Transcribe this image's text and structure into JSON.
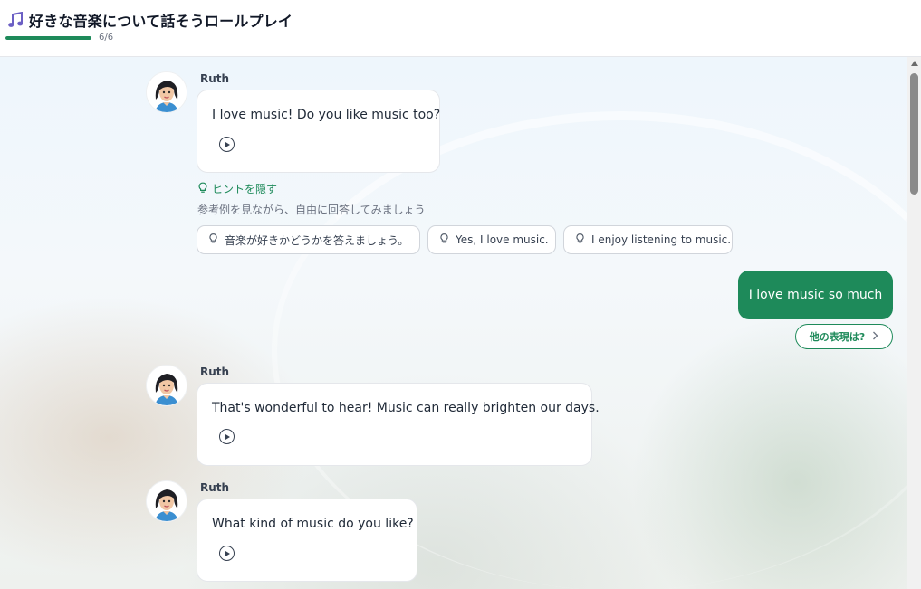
{
  "header": {
    "title": "好きな音楽について話そうロールプレイ",
    "icon": "music-note-icon",
    "progress_text": "6/6",
    "progress_fraction": 1.0,
    "accent_color": "#1e8a5a"
  },
  "messages": [
    {
      "sender": "Ruth",
      "text": "I love music! Do you like music too?"
    },
    {
      "sender": "Ruth",
      "text": "That's wonderful to hear! Music can really brighten our days."
    },
    {
      "sender": "Ruth",
      "text": "What kind of music do you like?"
    }
  ],
  "hints": {
    "toggle_label": "ヒントを隠す",
    "description": "参考例を見ながら、自由に回答してみましょう",
    "chips": [
      "音楽が好きかどうかを答えましょう。",
      "Yes, I love music.",
      "I enjoy listening to music."
    ]
  },
  "user_message": {
    "text": "I love music so much",
    "alt_label": "他の表現は?"
  }
}
